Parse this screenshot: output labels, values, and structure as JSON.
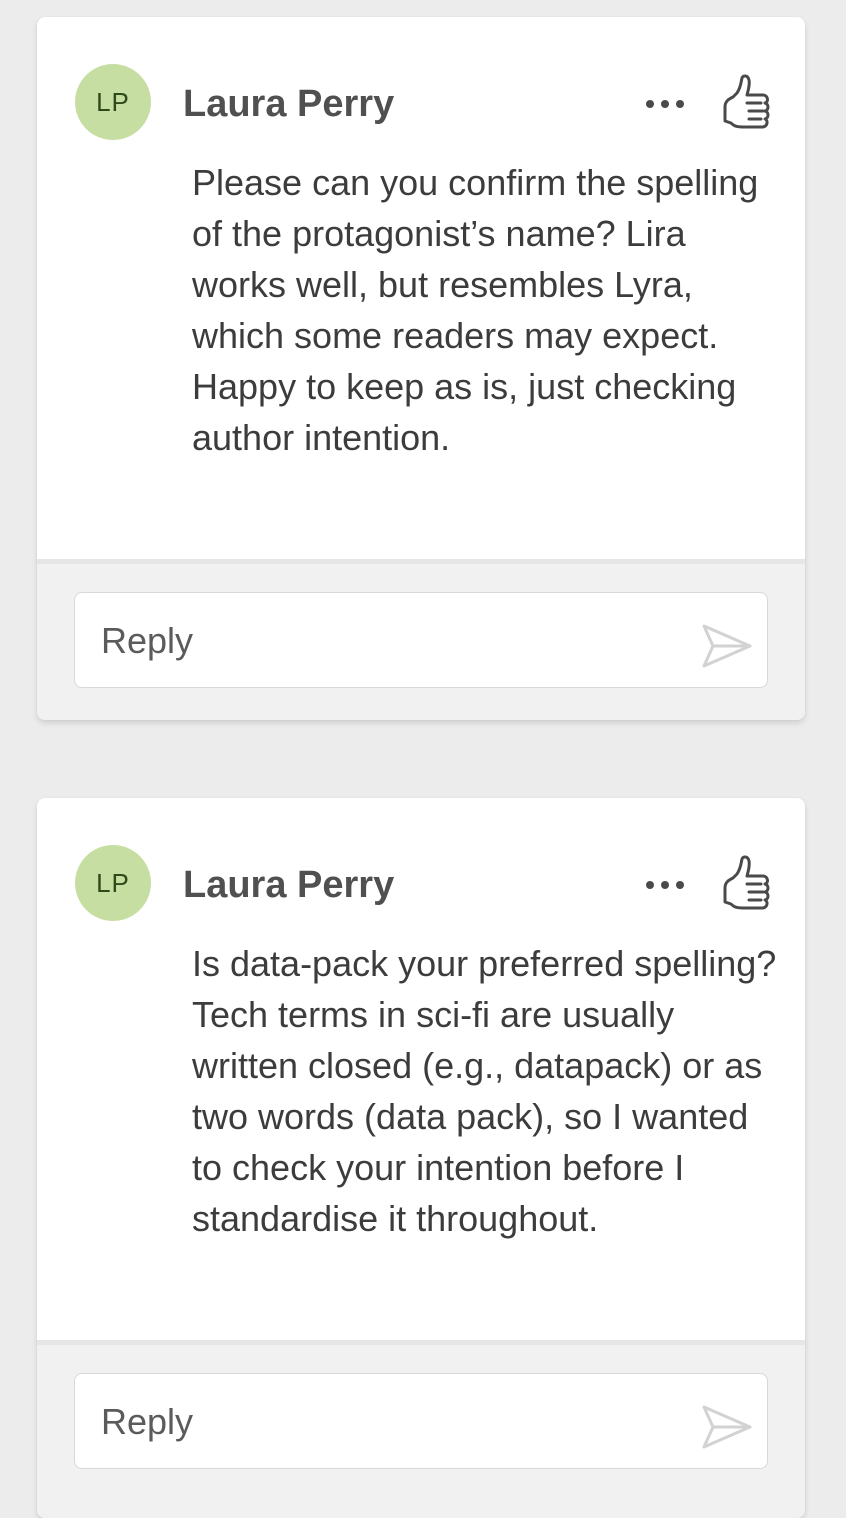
{
  "comments": [
    {
      "avatar_initials": "LP",
      "author": "Laura Perry",
      "more_icon": "ellipsis-icon",
      "like_icon": "thumbs-up-icon",
      "text": "Please can you confirm the spelling of the protagonist’s name? Lira works well, but resembles Lyra, which some readers may expect. Happy to keep as is, just checking author intention.",
      "reply": {
        "placeholder": "Reply",
        "value": "",
        "send_icon": "send-icon"
      }
    },
    {
      "avatar_initials": "LP",
      "author": "Laura Perry",
      "more_icon": "ellipsis-icon",
      "like_icon": "thumbs-up-icon",
      "text": "Is data-pack your preferred spelling? Tech terms in sci-fi are usually written closed (e.g., datapack) or as two words (data pack), so I wanted to check your intention before I standardise it throughout.",
      "reply": {
        "placeholder": "Reply",
        "value": "",
        "send_icon": "send-icon"
      }
    }
  ],
  "colors": {
    "page_background": "#ececec",
    "card_background": "#ffffff",
    "avatar_background": "#c7dea3",
    "footer_background": "#f1f1f1"
  }
}
